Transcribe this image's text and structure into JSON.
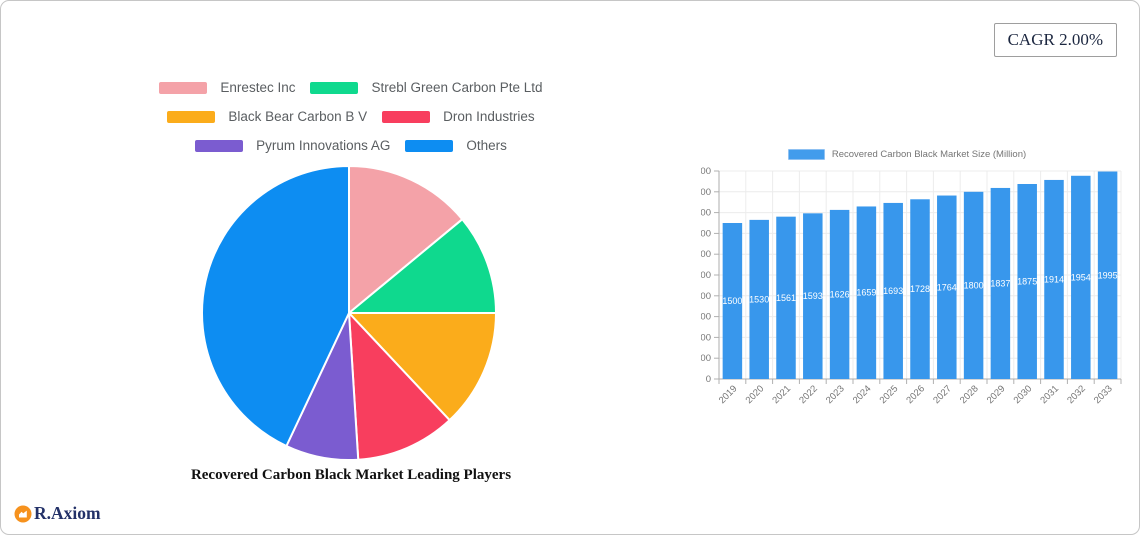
{
  "badge": {
    "label": "CAGR 2.00%"
  },
  "brand": {
    "name": "R.Axiom",
    "logo_icon": "chart-icon",
    "logo_color": "#F6921E"
  },
  "chart_data": [
    {
      "type": "pie",
      "title": "Recovered Carbon Black Market Leading Players",
      "labels": [
        "Enrestec Inc",
        "Strebl Green Carbon Pte Ltd",
        "Black Bear Carbon B V",
        "Dron Industries",
        "Pyrum Innovations AG",
        "Others"
      ],
      "values_percent": [
        14,
        11,
        13,
        11,
        8,
        43
      ],
      "colors": [
        "#F4A2A8",
        "#0FD98E",
        "#FBAC1B",
        "#F83E5E",
        "#7B5CD0",
        "#0D8DF2"
      ],
      "legend_position": "top",
      "start_angle": 0,
      "direction": "clockwise"
    },
    {
      "type": "bar",
      "legend": "Recovered Carbon Black Market Size (Million)",
      "categories": [
        "2019",
        "2020",
        "2021",
        "2022",
        "2023",
        "2024",
        "2025",
        "2026",
        "2027",
        "2028",
        "2029",
        "2030",
        "2031",
        "2032",
        "2033"
      ],
      "values": [
        1500,
        1530,
        1561,
        1593,
        1626,
        1659,
        1693,
        1728,
        1764,
        1800,
        1837,
        1875,
        1914,
        1954,
        1995
      ],
      "xlabel": "",
      "ylabel": "",
      "ylim": [
        0,
        2000
      ],
      "ytick_step": 200,
      "bar_color": "#3897EC",
      "value_label_color": "#ffffff",
      "grid": true,
      "legend_position": "top"
    }
  ]
}
